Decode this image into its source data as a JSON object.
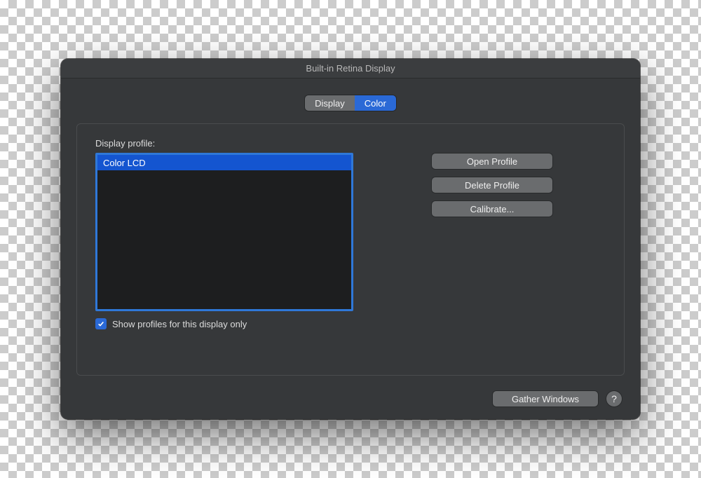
{
  "window": {
    "title": "Built-in Retina Display"
  },
  "tabs": {
    "display": "Display",
    "color": "Color",
    "selected": "color"
  },
  "section": {
    "label": "Display profile:"
  },
  "profiles": {
    "items": [
      "Color LCD"
    ],
    "selected_index": 0
  },
  "checkbox": {
    "checked": true,
    "label": "Show profiles for this display only"
  },
  "actions": {
    "open": "Open Profile",
    "delete": "Delete Profile",
    "calibrate": "Calibrate...",
    "gather": "Gather Windows",
    "help": "?"
  }
}
